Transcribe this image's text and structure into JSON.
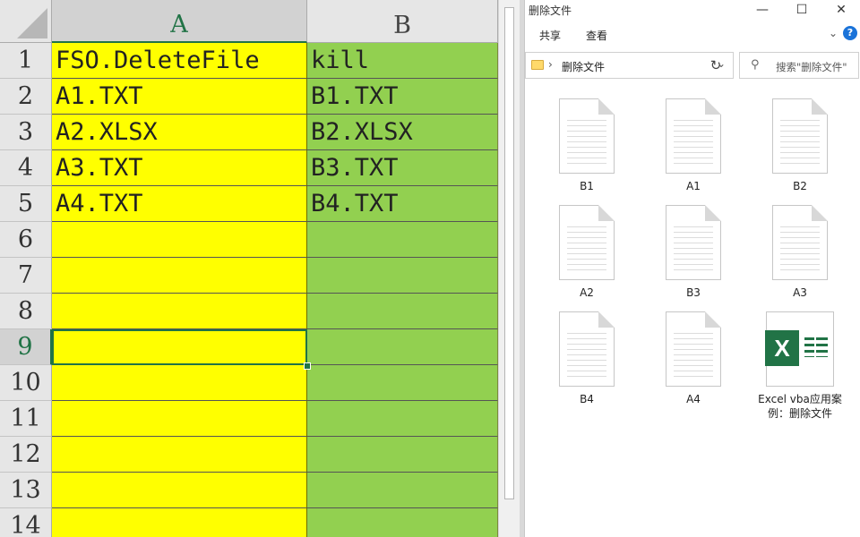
{
  "sheet": {
    "columns": [
      "A",
      "B"
    ],
    "rows": [
      "1",
      "2",
      "3",
      "4",
      "5",
      "6",
      "7",
      "8",
      "9",
      "10",
      "11",
      "12",
      "13",
      "14"
    ],
    "cells": [
      [
        "FSO.DeleteFile",
        "kill"
      ],
      [
        "A1.TXT",
        "B1.TXT"
      ],
      [
        "A2.XLSX",
        "B2.XLSX"
      ],
      [
        "A3.TXT",
        "B3.TXT"
      ],
      [
        "A4.TXT",
        "B4.TXT"
      ],
      [
        "",
        ""
      ],
      [
        "",
        ""
      ],
      [
        "",
        ""
      ],
      [
        "",
        ""
      ],
      [
        "",
        ""
      ],
      [
        "",
        ""
      ],
      [
        "",
        ""
      ],
      [
        "",
        ""
      ],
      [
        "",
        ""
      ]
    ],
    "active_cell": "A9",
    "colors": {
      "col_a_fill": "#ffff00",
      "col_b_fill": "#92d050",
      "selection": "#217346"
    }
  },
  "explorer": {
    "title": "删除文件",
    "window_buttons": {
      "minimize": "—",
      "maximize": "☐",
      "close": "✕"
    },
    "ribbon": {
      "share": "共享",
      "view": "查看",
      "expand": "⌄",
      "help": "?"
    },
    "address": {
      "separator": "›",
      "path": "删除文件",
      "dropdown": "⌄",
      "refresh": "↻"
    },
    "search": {
      "icon": "search-icon",
      "placeholder": "搜索\"删除文件\""
    },
    "files": [
      {
        "name": "B1",
        "icon": "text-document-icon"
      },
      {
        "name": "A1",
        "icon": "text-document-icon"
      },
      {
        "name": "B2",
        "icon": "text-document-icon"
      },
      {
        "name": "A2",
        "icon": "text-document-icon"
      },
      {
        "name": "B3",
        "icon": "text-document-icon"
      },
      {
        "name": "A3",
        "icon": "text-document-icon"
      },
      {
        "name": "B4",
        "icon": "text-document-icon"
      },
      {
        "name": "A4",
        "icon": "text-document-icon"
      },
      {
        "name": "Excel vba应用案例：删除文件",
        "icon": "excel-file-icon",
        "badge": "X"
      }
    ]
  }
}
